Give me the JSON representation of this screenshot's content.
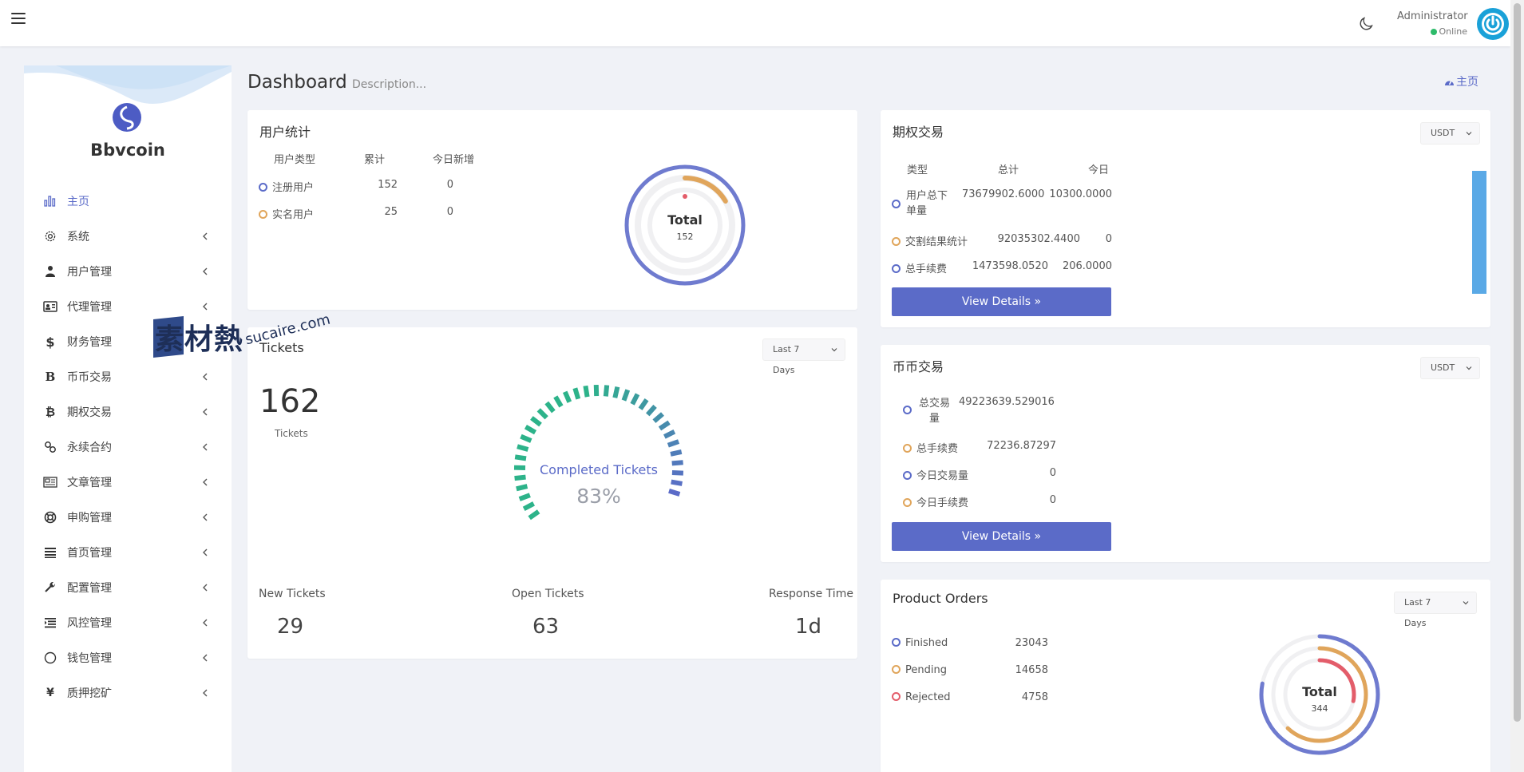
{
  "header": {
    "user_name": "Administrator",
    "user_status": "Online"
  },
  "sidebar": {
    "brand": "Bbvcoin",
    "items": [
      {
        "label": "主页",
        "icon": "bar-chart-icon"
      },
      {
        "label": "系统",
        "icon": "gear-icon"
      },
      {
        "label": "用户管理",
        "icon": "user-icon"
      },
      {
        "label": "代理管理",
        "icon": "id-card-icon"
      },
      {
        "label": "财务管理",
        "icon": "dollar-icon"
      },
      {
        "label": "币币交易",
        "icon": "b-letter-icon"
      },
      {
        "label": "期权交易",
        "icon": "bitcoin-icon"
      },
      {
        "label": "永续合约",
        "icon": "link-icon"
      },
      {
        "label": "文章管理",
        "icon": "newspaper-icon"
      },
      {
        "label": "申购管理",
        "icon": "lifebuoy-icon"
      },
      {
        "label": "首页管理",
        "icon": "list-icon"
      },
      {
        "label": "配置管理",
        "icon": "wrench-icon"
      },
      {
        "label": "风控管理",
        "icon": "indent-list-icon"
      },
      {
        "label": "钱包管理",
        "icon": "circle-icon"
      },
      {
        "label": "质押挖矿",
        "icon": "yen-icon"
      }
    ]
  },
  "page": {
    "title": "Dashboard",
    "description": "Description...",
    "breadcrumb": "主页"
  },
  "user_stats": {
    "title": "用户统计",
    "headers": [
      "用户类型",
      "累计",
      "今日新增"
    ],
    "rows": [
      {
        "type": "注册用户",
        "total": "152",
        "today": "0"
      },
      {
        "type": "实名用户",
        "total": "25",
        "today": "0"
      }
    ],
    "donut_label": "Total",
    "donut_value": "152",
    "donut_fraction": 0.165
  },
  "tickets": {
    "title": "Tickets",
    "filter": "Last 7 Days",
    "count": "162",
    "count_label": "Tickets",
    "gauge_label": "Completed Tickets",
    "gauge_value": "83%",
    "gauge_fraction": 0.83,
    "stats": [
      {
        "label": "New Tickets",
        "value": "29"
      },
      {
        "label": "Open Tickets",
        "value": "63"
      },
      {
        "label": "Response Time",
        "value": "1d"
      }
    ]
  },
  "options": {
    "title": "期权交易",
    "currency": "USDT",
    "headers": [
      "类型",
      "总计",
      "今日"
    ],
    "rows": [
      {
        "type_line1": "用户总下",
        "type_line2": "单量",
        "total": "73679902.6000",
        "today": "10300.0000"
      },
      {
        "type_line1": "交割结果统计",
        "type_line2": "",
        "total": "92035302.4400",
        "today": "0"
      },
      {
        "type_line1": "总手续费",
        "type_line2": "",
        "total": "1473598.0520",
        "today": "206.0000"
      }
    ],
    "button": "View Details"
  },
  "spot": {
    "title": "币币交易",
    "currency": "USDT",
    "rows": [
      {
        "label_line1": "总交易",
        "label_line2": "量",
        "value": "49223639.529016"
      },
      {
        "label_line1": "总手续费",
        "label_line2": "",
        "value": "72236.87297"
      },
      {
        "label_line1": "今日交易量",
        "label_line2": "",
        "value": "0"
      },
      {
        "label_line1": "今日手续费",
        "label_line2": "",
        "value": "0"
      }
    ],
    "button": "View Details"
  },
  "orders": {
    "title": "Product Orders",
    "filter": "Last 7 Days",
    "rows": [
      {
        "label": "Finished",
        "value": "23043"
      },
      {
        "label": "Pending",
        "value": "14658"
      },
      {
        "label": "Rejected",
        "value": "4758"
      }
    ],
    "donut_label": "Total",
    "donut_value": "344",
    "ring_fractions": [
      0.78,
      0.62,
      0.28
    ]
  },
  "watermark": {
    "main": "素材熱",
    "url": "sucaire.com"
  },
  "colors": {
    "accent": "#5b6bc8",
    "orange": "#e0a55b",
    "red": "#e35d6a",
    "green": "#2db38a",
    "bar": "#5aa9e6"
  }
}
